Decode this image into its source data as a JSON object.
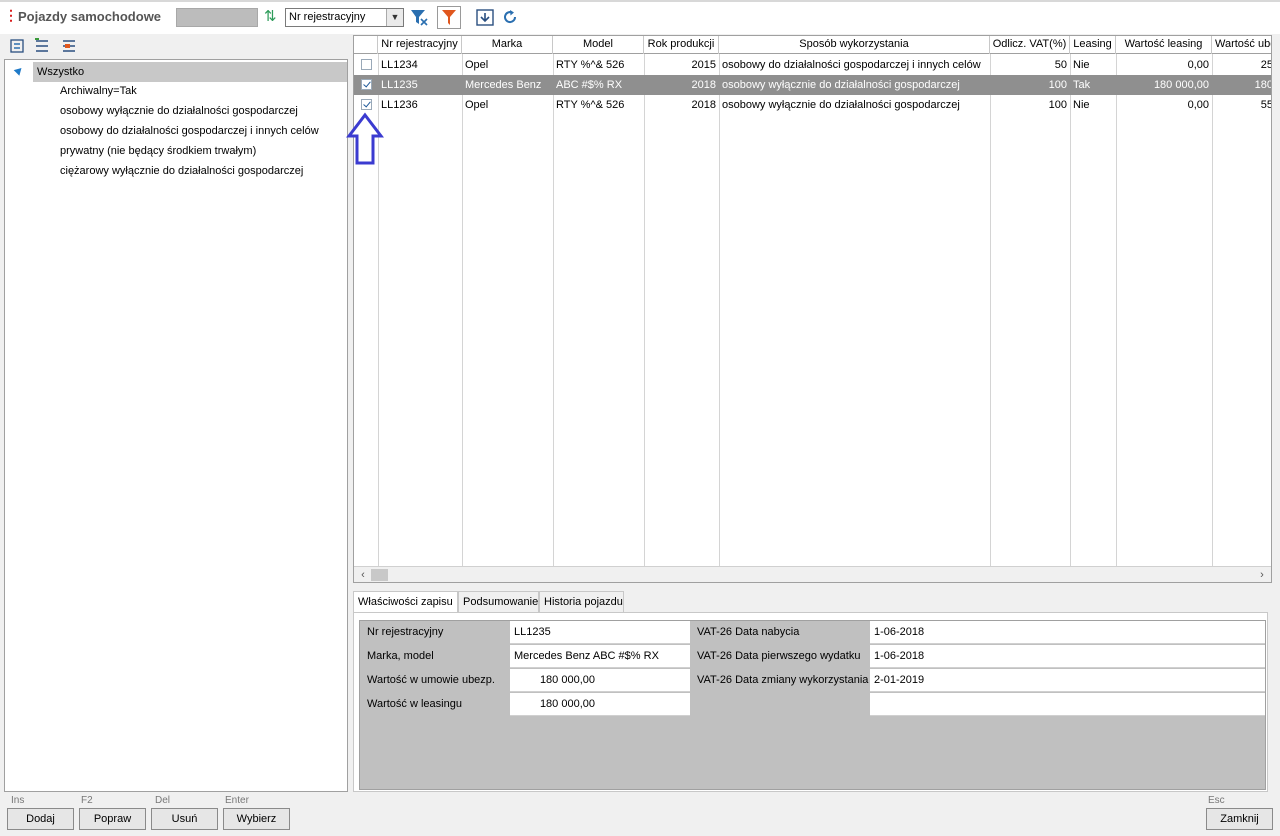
{
  "header": {
    "title": "Pojazdy samochodowe",
    "sort_field": "Nr rejestracyjny"
  },
  "tree": {
    "root": "Wszystko",
    "items": [
      "Archiwalny=Tak",
      "osobowy wyłącznie do działalności gospodarczej",
      "osobowy do działalności gospodarczej i innych celów",
      "prywatny (nie będący środkiem trwałym)",
      "ciężarowy wyłącznie do działalności gospodarczej"
    ]
  },
  "grid": {
    "columns": [
      "Nr rejestracyjny",
      "Marka",
      "Model",
      "Rok produkcji",
      "Sposób wykorzystania",
      "Odlicz. VAT(%)",
      "Leasing",
      "Wartość leasing",
      "Wartość ube"
    ],
    "rows": [
      {
        "checked": false,
        "selected": false,
        "nr": "LL1234",
        "marka": "Opel",
        "model": "RTY %^& 526",
        "rok": "2015",
        "sposob": "osobowy do działalności gospodarczej i innych celów",
        "vat": "50",
        "leasing": "Nie",
        "wartosc_leasing": "0,00",
        "wartosc_ube": "25"
      },
      {
        "checked": true,
        "selected": true,
        "nr": "LL1235",
        "marka": "Mercedes Benz",
        "model": "ABC #$% RX",
        "rok": "2018",
        "sposob": "osobowy wyłącznie do działalności gospodarczej",
        "vat": "100",
        "leasing": "Tak",
        "wartosc_leasing": "180 000,00",
        "wartosc_ube": "180"
      },
      {
        "checked": true,
        "selected": false,
        "nr": "LL1236",
        "marka": "Opel",
        "model": "RTY %^& 526",
        "rok": "2018",
        "sposob": "osobowy wyłącznie do działalności gospodarczej",
        "vat": "100",
        "leasing": "Nie",
        "wartosc_leasing": "0,00",
        "wartosc_ube": "55"
      }
    ]
  },
  "tabs": [
    "Właściwości zapisu",
    "Podsumowanie",
    "Historia pojazdu"
  ],
  "properties": {
    "nr_label": "Nr rejestracyjny",
    "nr_value": "LL1235",
    "marka_label": "Marka, model",
    "marka_value": "Mercedes Benz ABC #$% RX",
    "ubezp_label": "Wartość w umowie ubezp.",
    "ubezp_value": "180 000,00",
    "leasing_label": "Wartość w leasingu",
    "leasing_value": "180 000,00",
    "nabycia_label": "VAT-26 Data nabycia",
    "nabycia_value": "1-06-2018",
    "wydatku_label": "VAT-26 Data pierwszego wydatku",
    "wydatku_value": "1-06-2018",
    "zmiany_label": "VAT-26 Data zmiany wykorzystania",
    "zmiany_value": "2-01-2019"
  },
  "buttons": {
    "add": {
      "hotkey": "Ins",
      "label": "Dodaj"
    },
    "edit": {
      "hotkey": "F2",
      "label": "Popraw"
    },
    "delete": {
      "hotkey": "Del",
      "label": "Usuń"
    },
    "choose": {
      "hotkey": "Enter",
      "label": "Wybierz"
    },
    "close": {
      "hotkey": "Esc",
      "label": "Zamknij"
    }
  },
  "colors": {
    "selected_row": "#8f8f8f",
    "annotation_arrow": "#3b3bd0",
    "filter_icon": "#e0571e",
    "title_dots": "#d81e1e"
  }
}
